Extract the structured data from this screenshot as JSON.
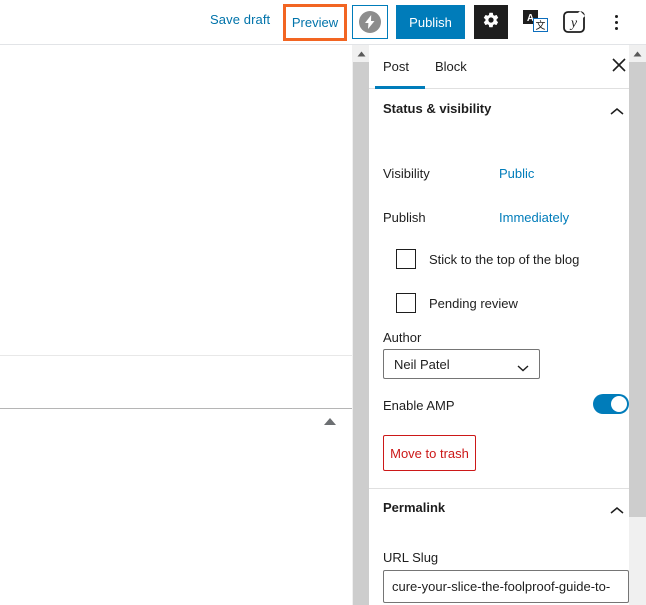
{
  "toolbar": {
    "save_draft_label": "Save draft",
    "preview_label": "Preview",
    "publish_label": "Publish",
    "amp_icon": "amp-lightning-icon",
    "settings_icon": "gear-icon",
    "translate_icon": "translate-icon",
    "translate_letter": "A",
    "translate_cjk": "文",
    "yoast_icon": "yoast-seo-icon",
    "yoast_letter": "y",
    "more_icon": "more-vertical-icon",
    "highlight_color": "#f26522",
    "link_color": "#0073aa",
    "publish_bg": "#007cba"
  },
  "editor": {
    "caret_icon": "triangle-up-icon"
  },
  "sidebar": {
    "tabs": [
      {
        "label": "Post",
        "active": true
      },
      {
        "label": "Block",
        "active": false
      }
    ],
    "close_icon": "close-icon",
    "panels": [
      {
        "title": "Status & visibility",
        "chevron_icon": "chevron-up-icon",
        "rows": [
          {
            "label": "Visibility",
            "value": "Public"
          },
          {
            "label": "Publish",
            "value": "Immediately"
          }
        ],
        "checkboxes": [
          {
            "label": "Stick to the top of the blog",
            "checked": false
          },
          {
            "label": "Pending review",
            "checked": false
          }
        ],
        "author": {
          "label": "Author",
          "selected": "Neil Patel",
          "chevron_icon": "chevron-down-icon"
        },
        "amp": {
          "label": "Enable AMP",
          "enabled": true,
          "toggle_color": "#007cba"
        },
        "trash": {
          "label": "Move to trash",
          "color": "#cc1818"
        }
      },
      {
        "title": "Permalink",
        "chevron_icon": "chevron-up-icon",
        "slug": {
          "label": "URL Slug",
          "value": "cure-your-slice-the-foolproof-guide-to-",
          "placeholder": "URL Slug"
        }
      }
    ]
  },
  "scrollbars": {
    "outer_up_icon": "scroll-up-arrow-icon",
    "inner_up_icon": "scroll-up-arrow-icon"
  }
}
